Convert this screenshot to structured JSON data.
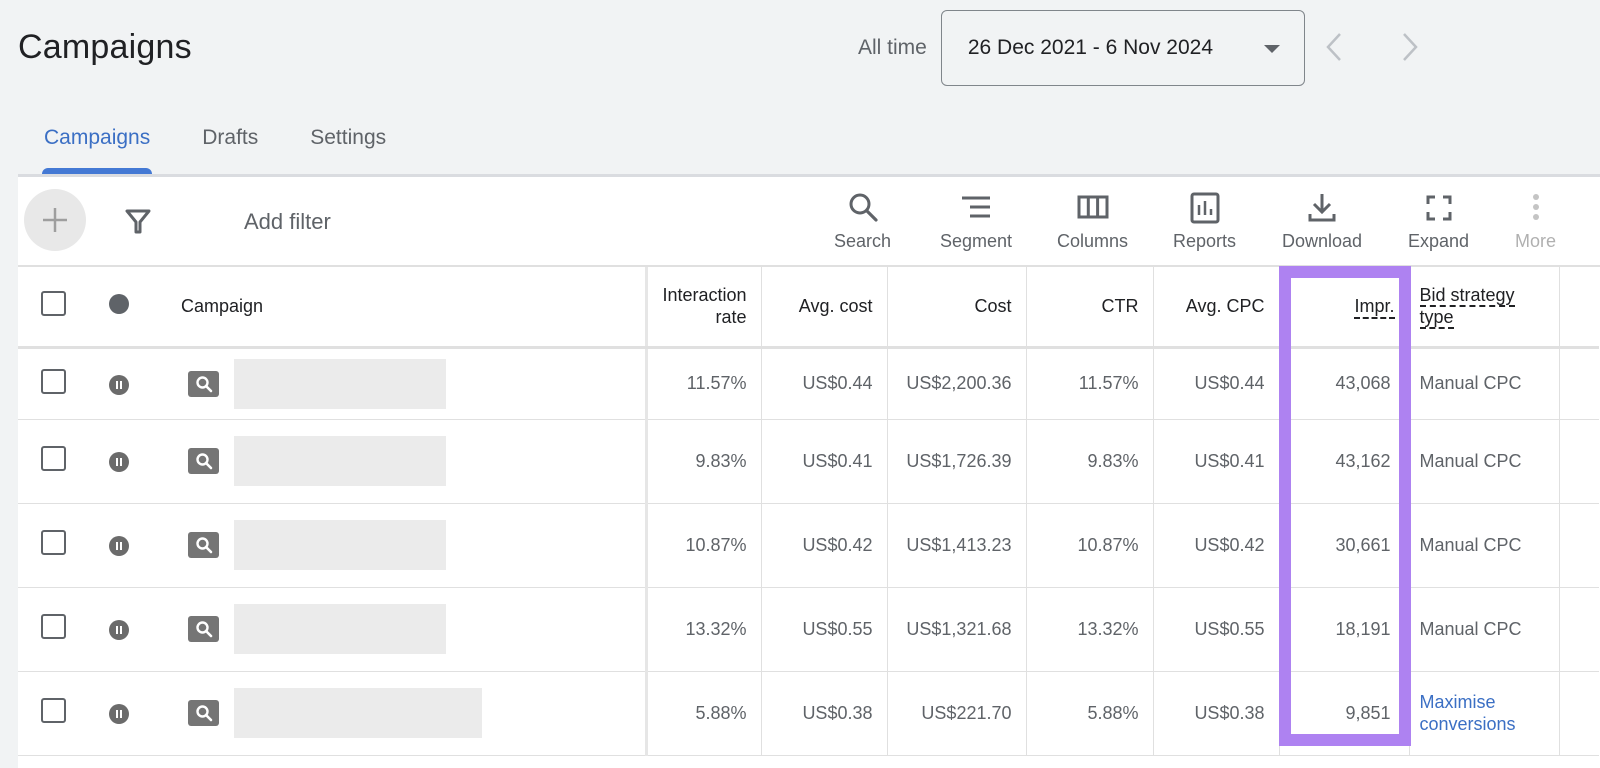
{
  "header": {
    "title": "Campaigns",
    "date_range_label": "All time",
    "date_range_value": "26 Dec 2021 - 6 Nov 2024"
  },
  "tabs": [
    {
      "label": "Campaigns",
      "active": true
    },
    {
      "label": "Drafts",
      "active": false
    },
    {
      "label": "Settings",
      "active": false
    }
  ],
  "toolbar": {
    "add_filter": "Add filter",
    "tools": [
      {
        "label": "Search",
        "icon": "search-icon"
      },
      {
        "label": "Segment",
        "icon": "segment-icon"
      },
      {
        "label": "Columns",
        "icon": "columns-icon"
      },
      {
        "label": "Reports",
        "icon": "reports-icon"
      },
      {
        "label": "Download",
        "icon": "download-icon"
      },
      {
        "label": "Expand",
        "icon": "expand-icon"
      },
      {
        "label": "More",
        "icon": "more-vert-icon"
      }
    ]
  },
  "table": {
    "headers": {
      "campaign": "Campaign",
      "interaction_rate_1": "Interaction",
      "interaction_rate_2": "rate",
      "avg_cost": "Avg. cost",
      "cost": "Cost",
      "ctr": "CTR",
      "avg_cpc": "Avg. CPC",
      "impr": "Impr.",
      "bid_1": "Bid strategy",
      "bid_2": "type"
    },
    "rows": [
      {
        "status": "paused",
        "type": "search",
        "interaction_rate": "11.57%",
        "avg_cost": "US$0.44",
        "cost": "US$2,200.36",
        "ctr": "11.57%",
        "avg_cpc": "US$0.44",
        "impr": "43,068",
        "bid_1": "Manual CPC",
        "bid_2": ""
      },
      {
        "status": "paused",
        "type": "search",
        "interaction_rate": "9.83%",
        "avg_cost": "US$0.41",
        "cost": "US$1,726.39",
        "ctr": "9.83%",
        "avg_cpc": "US$0.41",
        "impr": "43,162",
        "bid_1": "Manual CPC",
        "bid_2": ""
      },
      {
        "status": "paused",
        "type": "search",
        "interaction_rate": "10.87%",
        "avg_cost": "US$0.42",
        "cost": "US$1,413.23",
        "ctr": "10.87%",
        "avg_cpc": "US$0.42",
        "impr": "30,661",
        "bid_1": "Manual CPC",
        "bid_2": ""
      },
      {
        "status": "paused",
        "type": "search",
        "interaction_rate": "13.32%",
        "avg_cost": "US$0.55",
        "cost": "US$1,321.68",
        "ctr": "13.32%",
        "avg_cpc": "US$0.55",
        "impr": "18,191",
        "bid_1": "Manual CPC",
        "bid_2": ""
      },
      {
        "status": "paused",
        "type": "search",
        "interaction_rate": "5.88%",
        "avg_cost": "US$0.38",
        "cost": "US$221.70",
        "ctr": "5.88%",
        "avg_cpc": "US$0.38",
        "impr": "9,851",
        "bid_1": "Maximise",
        "bid_2": "conversions",
        "bid_is_link": true
      }
    ]
  },
  "colors": {
    "accent_blue": "#3b6fc4",
    "highlight_purple": "#ae82f1"
  }
}
